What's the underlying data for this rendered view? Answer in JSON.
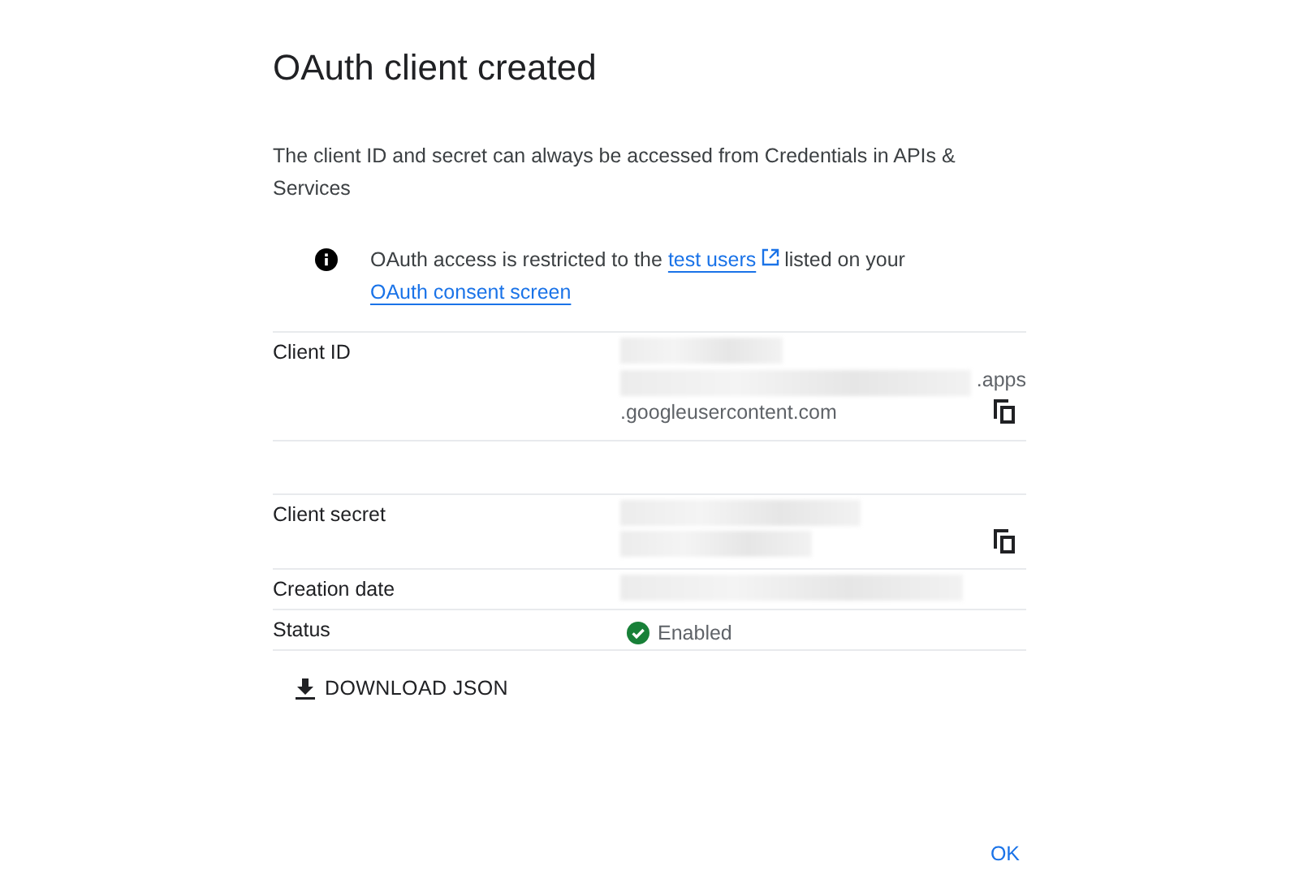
{
  "dialog": {
    "title": "OAuth client created",
    "description": "The client ID and secret can always be accessed from Credentials in APIs & Services",
    "notice": {
      "text_before": "OAuth access is restricted to the",
      "link_1": "test users",
      "text_middle": "listed on your",
      "link_2": "OAuth consent screen"
    },
    "fields": [
      {
        "kind": "client_id",
        "label": "Client ID",
        "suffix": ".apps",
        "domain": ".googleusercontent.com",
        "copyable": true
      },
      {
        "kind": "secret",
        "label": "Client secret",
        "copyable": true
      },
      {
        "kind": "date",
        "label": "Creation date"
      },
      {
        "kind": "status",
        "label": "Status",
        "value": "Enabled",
        "enabled": true
      }
    ],
    "download_button": "DOWNLOAD JSON",
    "ok_button": "OK"
  }
}
